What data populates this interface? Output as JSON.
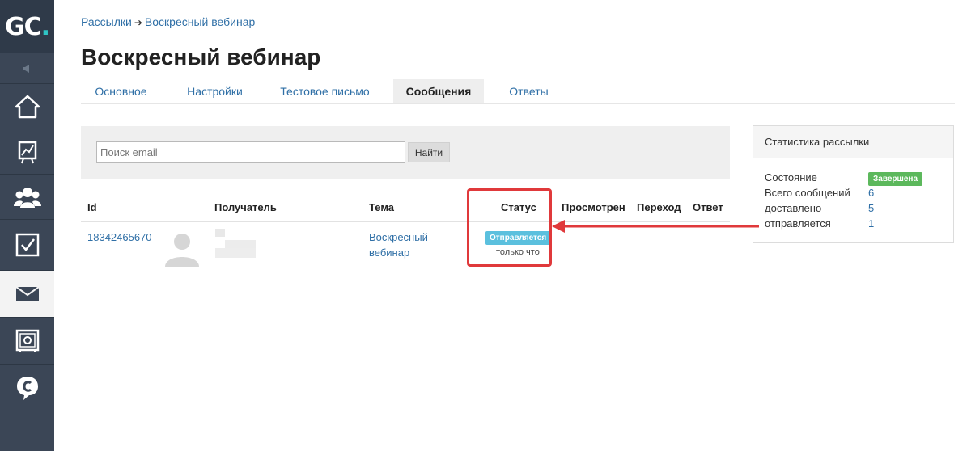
{
  "logo": {
    "text": "GC",
    "dot": "."
  },
  "sidebar": {
    "items": [
      {
        "icon": "home-icon"
      },
      {
        "icon": "chart-icon"
      },
      {
        "icon": "users-icon"
      },
      {
        "icon": "checkbox-icon"
      },
      {
        "icon": "mail-icon",
        "active": true
      },
      {
        "icon": "safe-icon"
      },
      {
        "icon": "chat-icon"
      }
    ]
  },
  "breadcrumb": {
    "parent": "Рассылки",
    "separator": "➔",
    "current": "Воскресный вебинар"
  },
  "page_title": "Воскресный вебинар",
  "tabs": [
    {
      "label": "Основное"
    },
    {
      "label": "Настройки"
    },
    {
      "label": "Тестовое письмо"
    },
    {
      "label": "Сообщения",
      "active": true
    },
    {
      "label": "Ответы"
    }
  ],
  "search": {
    "placeholder": "Поиск email",
    "value": "",
    "button": "Найти"
  },
  "table": {
    "headers": [
      "Id",
      "Получатель",
      "Тема",
      "Статус",
      "Просмотрен",
      "Переход",
      "Ответ"
    ],
    "rows": [
      {
        "id": "18342465670",
        "recipient": "",
        "theme": "Воскресный вебинар",
        "status": "Отправляется",
        "status_time": "только что",
        "viewed": "",
        "clicked": "",
        "reply": ""
      }
    ]
  },
  "stats": {
    "title": "Статистика рассылки",
    "state_label": "Состояние",
    "state_value": "Завершена",
    "total_label": "Всего сообщений",
    "total_value": "6",
    "delivered_label": "доставлено",
    "delivered_value": "5",
    "sending_label": "отправляется",
    "sending_value": "1"
  },
  "colors": {
    "sidebar": "#3b4656",
    "link": "#2f6fa6",
    "status_sending": "#5bc0de",
    "status_done": "#5cb85c",
    "highlight": "#e0393b"
  }
}
